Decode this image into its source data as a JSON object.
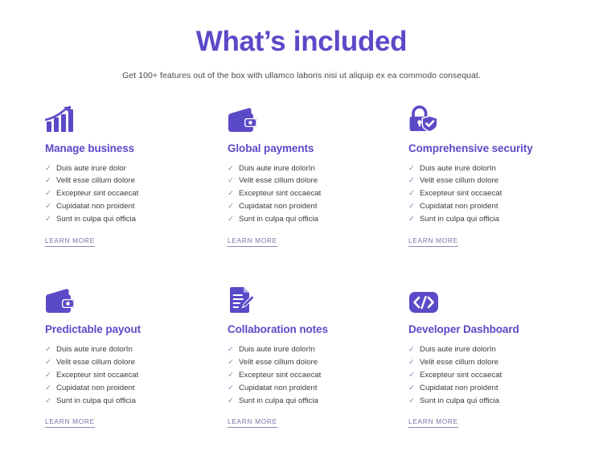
{
  "header": {
    "title": "What’s included",
    "subtitle": "Get 100+ features out of the box with ullamco laboris nisi ut aliquip ex ea commodo consequat."
  },
  "theme": {
    "accent": "#5b4ac8",
    "body_text": "#3c3c3c",
    "muted": "#7a72a8",
    "background": "#ffffff"
  },
  "common": {
    "check_glyph": "✓",
    "learn_more_label": "LEARN MORE"
  },
  "cards": [
    {
      "icon": "bar-chart-growth-icon",
      "title": "Manage business",
      "items": [
        "Duis aute irure dolor",
        "Velit esse cillum dolore",
        "Excepteur sint occaecat",
        "Cupidatat non proident",
        "Sunt in culpa qui officia"
      ],
      "link": "LEARN MORE"
    },
    {
      "icon": "wallet-icon",
      "title": "Global payments",
      "items": [
        "Duis aute irure dolorIn",
        "Velit esse cillum dolore",
        "Excepteur sint occaecat",
        "Cupidatat non proident",
        "Sunt in culpa qui officia"
      ],
      "link": "LEARN MORE"
    },
    {
      "icon": "padlock-shield-check-icon",
      "title": "Comprehensive security",
      "items": [
        "Duis aute irure dolorIn",
        "Velit esse cillum dolore",
        "Excepteur sint occaecat",
        "Cupidatat non proident",
        "Sunt in culpa qui officia"
      ],
      "link": "LEARN MORE"
    },
    {
      "icon": "wallet-icon",
      "title": "Predictable payout",
      "items": [
        "Duis aute irure dolorIn",
        "Velit esse cillum dolore",
        "Excepteur sint occaecat",
        "Cupidatat non proident",
        "Sunt in culpa qui officia"
      ],
      "link": "LEARN MORE"
    },
    {
      "icon": "document-pencil-icon",
      "title": "Collaboration notes",
      "items": [
        "Duis aute irure dolorIn",
        "Velit esse cillum dolore",
        "Excepteur sint occaecat",
        "Cupidatat non proident",
        "Sunt in culpa qui officia"
      ],
      "link": "LEARN MORE"
    },
    {
      "icon": "code-brackets-icon",
      "title": "Developer Dashboard",
      "items": [
        "Duis aute irure dolorIn",
        "Velit esse cillum dolore",
        "Excepteur sint occaecat",
        "Cupidatat non proident",
        "Sunt in culpa qui officia"
      ],
      "link": "LEARN MORE"
    }
  ]
}
